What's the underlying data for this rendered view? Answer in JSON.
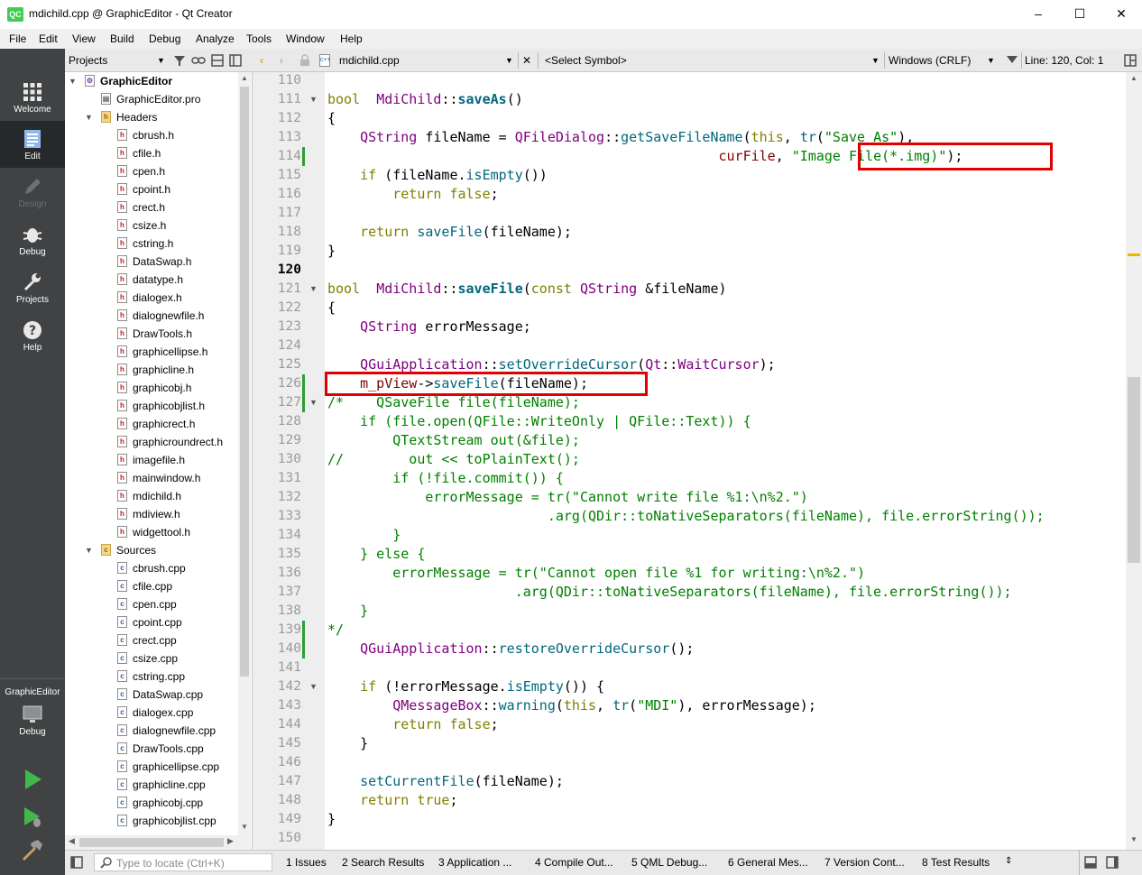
{
  "window": {
    "logo": "QC",
    "title": "mdichild.cpp @ GraphicEditor - Qt Creator",
    "minimize": "–",
    "maximize": "☐",
    "close": "✕"
  },
  "menu": [
    "File",
    "Edit",
    "View",
    "Build",
    "Debug",
    "Analyze",
    "Tools",
    "Window",
    "Help"
  ],
  "modes": {
    "welcome": "Welcome",
    "edit": "Edit",
    "design": "Design",
    "debug": "Debug",
    "projects": "Projects",
    "help": "Help",
    "target_project": "GraphicEditor",
    "target_config": "Debug"
  },
  "project_panel": {
    "title": "Projects",
    "tree": [
      {
        "label": "GraphicEditor",
        "depth": 0,
        "kind": "project",
        "expanded": true
      },
      {
        "label": "GraphicEditor.pro",
        "depth": 1,
        "kind": "pro"
      },
      {
        "label": "Headers",
        "depth": 1,
        "kind": "folder",
        "expanded": true
      },
      {
        "label": "cbrush.h",
        "depth": 2,
        "kind": "h"
      },
      {
        "label": "cfile.h",
        "depth": 2,
        "kind": "h"
      },
      {
        "label": "cpen.h",
        "depth": 2,
        "kind": "h"
      },
      {
        "label": "cpoint.h",
        "depth": 2,
        "kind": "h"
      },
      {
        "label": "crect.h",
        "depth": 2,
        "kind": "h"
      },
      {
        "label": "csize.h",
        "depth": 2,
        "kind": "h"
      },
      {
        "label": "cstring.h",
        "depth": 2,
        "kind": "h"
      },
      {
        "label": "DataSwap.h",
        "depth": 2,
        "kind": "h"
      },
      {
        "label": "datatype.h",
        "depth": 2,
        "kind": "h"
      },
      {
        "label": "dialogex.h",
        "depth": 2,
        "kind": "h"
      },
      {
        "label": "dialognewfile.h",
        "depth": 2,
        "kind": "h"
      },
      {
        "label": "DrawTools.h",
        "depth": 2,
        "kind": "h"
      },
      {
        "label": "graphicellipse.h",
        "depth": 2,
        "kind": "h"
      },
      {
        "label": "graphicline.h",
        "depth": 2,
        "kind": "h"
      },
      {
        "label": "graphicobj.h",
        "depth": 2,
        "kind": "h"
      },
      {
        "label": "graphicobjlist.h",
        "depth": 2,
        "kind": "h"
      },
      {
        "label": "graphicrect.h",
        "depth": 2,
        "kind": "h"
      },
      {
        "label": "graphicroundrect.h",
        "depth": 2,
        "kind": "h"
      },
      {
        "label": "imagefile.h",
        "depth": 2,
        "kind": "h"
      },
      {
        "label": "mainwindow.h",
        "depth": 2,
        "kind": "h"
      },
      {
        "label": "mdichild.h",
        "depth": 2,
        "kind": "h"
      },
      {
        "label": "mdiview.h",
        "depth": 2,
        "kind": "h"
      },
      {
        "label": "widgettool.h",
        "depth": 2,
        "kind": "h"
      },
      {
        "label": "Sources",
        "depth": 1,
        "kind": "folder",
        "expanded": true
      },
      {
        "label": "cbrush.cpp",
        "depth": 2,
        "kind": "cpp"
      },
      {
        "label": "cfile.cpp",
        "depth": 2,
        "kind": "cpp"
      },
      {
        "label": "cpen.cpp",
        "depth": 2,
        "kind": "cpp"
      },
      {
        "label": "cpoint.cpp",
        "depth": 2,
        "kind": "cpp"
      },
      {
        "label": "crect.cpp",
        "depth": 2,
        "kind": "cpp"
      },
      {
        "label": "csize.cpp",
        "depth": 2,
        "kind": "cpp"
      },
      {
        "label": "cstring.cpp",
        "depth": 2,
        "kind": "cpp"
      },
      {
        "label": "DataSwap.cpp",
        "depth": 2,
        "kind": "cpp"
      },
      {
        "label": "dialogex.cpp",
        "depth": 2,
        "kind": "cpp"
      },
      {
        "label": "dialognewfile.cpp",
        "depth": 2,
        "kind": "cpp"
      },
      {
        "label": "DrawTools.cpp",
        "depth": 2,
        "kind": "cpp"
      },
      {
        "label": "graphicellipse.cpp",
        "depth": 2,
        "kind": "cpp"
      },
      {
        "label": "graphicline.cpp",
        "depth": 2,
        "kind": "cpp"
      },
      {
        "label": "graphicobj.cpp",
        "depth": 2,
        "kind": "cpp"
      },
      {
        "label": "graphicobjlist.cpp",
        "depth": 2,
        "kind": "cpp"
      }
    ]
  },
  "editor_toolbar": {
    "file": "mdichild.cpp",
    "symbol": "<Select Symbol>",
    "line_ending": "Windows (CRLF)",
    "position": "Line: 120, Col: 1"
  },
  "editor": {
    "current_line": 120,
    "lines": [
      {
        "n": 110,
        "tokens": []
      },
      {
        "n": 111,
        "fold": true,
        "tokens": [
          [
            "kw",
            "bool"
          ],
          [
            "",
            "  "
          ],
          [
            "ty",
            "MdiChild"
          ],
          [
            "",
            "::"
          ],
          [
            "fnb",
            "saveAs"
          ],
          [
            "",
            "()"
          ]
        ]
      },
      {
        "n": 112,
        "tokens": [
          [
            "",
            "{"
          ]
        ]
      },
      {
        "n": 113,
        "tokens": [
          [
            "",
            "    "
          ],
          [
            "ty",
            "QString"
          ],
          [
            "",
            " fileName = "
          ],
          [
            "ty",
            "QFileDialog"
          ],
          [
            "",
            "::"
          ],
          [
            "fn",
            "getSaveFileName"
          ],
          [
            "",
            "("
          ],
          [
            "kw",
            "this"
          ],
          [
            "",
            ", "
          ],
          [
            "fn",
            "tr"
          ],
          [
            "",
            "("
          ],
          [
            "st",
            "\"Save As\""
          ],
          [
            "",
            "),"
          ]
        ]
      },
      {
        "n": 114,
        "mark": true,
        "tokens": [
          [
            "",
            "                                                "
          ],
          [
            "var",
            "curFile"
          ],
          [
            "",
            ", "
          ],
          [
            "st",
            "\"Image File(*.img)\""
          ],
          [
            "",
            ");"
          ]
        ]
      },
      {
        "n": 115,
        "tokens": [
          [
            "",
            "    "
          ],
          [
            "kw",
            "if"
          ],
          [
            "",
            " (fileName."
          ],
          [
            "fn",
            "isEmpty"
          ],
          [
            "",
            "())"
          ]
        ]
      },
      {
        "n": 116,
        "tokens": [
          [
            "",
            "        "
          ],
          [
            "kw",
            "return"
          ],
          [
            "",
            " "
          ],
          [
            "kw",
            "false"
          ],
          [
            "",
            ";"
          ]
        ]
      },
      {
        "n": 117,
        "tokens": []
      },
      {
        "n": 118,
        "tokens": [
          [
            "",
            "    "
          ],
          [
            "kw",
            "return"
          ],
          [
            "",
            " "
          ],
          [
            "fn",
            "saveFile"
          ],
          [
            "",
            "(fileName);"
          ]
        ]
      },
      {
        "n": 119,
        "tokens": [
          [
            "",
            "}"
          ]
        ]
      },
      {
        "n": 120,
        "tokens": []
      },
      {
        "n": 121,
        "fold": true,
        "tokens": [
          [
            "kw",
            "bool"
          ],
          [
            "",
            "  "
          ],
          [
            "ty",
            "MdiChild"
          ],
          [
            "",
            "::"
          ],
          [
            "fnb",
            "saveFile"
          ],
          [
            "",
            "("
          ],
          [
            "kw",
            "const"
          ],
          [
            "",
            " "
          ],
          [
            "ty",
            "QString"
          ],
          [
            "",
            " &fileName)"
          ]
        ]
      },
      {
        "n": 122,
        "tokens": [
          [
            "",
            "{"
          ]
        ]
      },
      {
        "n": 123,
        "tokens": [
          [
            "",
            "    "
          ],
          [
            "ty",
            "QString"
          ],
          [
            "",
            " errorMessage;"
          ]
        ]
      },
      {
        "n": 124,
        "tokens": []
      },
      {
        "n": 125,
        "tokens": [
          [
            "",
            "    "
          ],
          [
            "ty",
            "QGuiApplication"
          ],
          [
            "",
            "::"
          ],
          [
            "fn",
            "setOverrideCursor"
          ],
          [
            "",
            "("
          ],
          [
            "ty",
            "Qt"
          ],
          [
            "",
            "::"
          ],
          [
            "ty",
            "WaitCursor"
          ],
          [
            "",
            ");"
          ]
        ]
      },
      {
        "n": 126,
        "mark": true,
        "tokens": [
          [
            "",
            "    "
          ],
          [
            "var",
            "m_pView"
          ],
          [
            "",
            "->"
          ],
          [
            "fn",
            "saveFile"
          ],
          [
            "",
            "(fileName);"
          ]
        ]
      },
      {
        "n": 127,
        "fold": true,
        "mark": true,
        "tokens": [
          [
            "cm",
            "/*    QSaveFile file(fileName);"
          ]
        ]
      },
      {
        "n": 128,
        "tokens": [
          [
            "cm",
            "    if (file.open(QFile::WriteOnly | QFile::Text)) {"
          ]
        ]
      },
      {
        "n": 129,
        "tokens": [
          [
            "cm",
            "        QTextStream out(&file);"
          ]
        ]
      },
      {
        "n": 130,
        "tokens": [
          [
            "cm",
            "//        out << toPlainText();"
          ]
        ]
      },
      {
        "n": 131,
        "tokens": [
          [
            "cm",
            "        if (!file.commit()) {"
          ]
        ]
      },
      {
        "n": 132,
        "tokens": [
          [
            "cm",
            "            errorMessage = tr(\"Cannot write file %1:\\n%2.\")"
          ]
        ]
      },
      {
        "n": 133,
        "tokens": [
          [
            "cm",
            "                           .arg(QDir::toNativeSeparators(fileName), file.errorString());"
          ]
        ]
      },
      {
        "n": 134,
        "tokens": [
          [
            "cm",
            "        }"
          ]
        ]
      },
      {
        "n": 135,
        "tokens": [
          [
            "cm",
            "    } else {"
          ]
        ]
      },
      {
        "n": 136,
        "tokens": [
          [
            "cm",
            "        errorMessage = tr(\"Cannot open file %1 for writing:\\n%2.\")"
          ]
        ]
      },
      {
        "n": 137,
        "tokens": [
          [
            "cm",
            "                       .arg(QDir::toNativeSeparators(fileName), file.errorString());"
          ]
        ]
      },
      {
        "n": 138,
        "tokens": [
          [
            "cm",
            "    }"
          ]
        ]
      },
      {
        "n": 139,
        "mark": true,
        "tokens": [
          [
            "cm",
            "*/"
          ]
        ]
      },
      {
        "n": 140,
        "mark": true,
        "tokens": [
          [
            "",
            "    "
          ],
          [
            "ty",
            "QGuiApplication"
          ],
          [
            "",
            "::"
          ],
          [
            "fn",
            "restoreOverrideCursor"
          ],
          [
            "",
            "();"
          ]
        ]
      },
      {
        "n": 141,
        "tokens": []
      },
      {
        "n": 142,
        "fold": true,
        "tokens": [
          [
            "",
            "    "
          ],
          [
            "kw",
            "if"
          ],
          [
            "",
            " (!errorMessage."
          ],
          [
            "fn",
            "isEmpty"
          ],
          [
            "",
            "()) {"
          ]
        ]
      },
      {
        "n": 143,
        "tokens": [
          [
            "",
            "        "
          ],
          [
            "ty",
            "QMessageBox"
          ],
          [
            "",
            "::"
          ],
          [
            "fn",
            "warning"
          ],
          [
            "",
            "("
          ],
          [
            "kw",
            "this"
          ],
          [
            "",
            ", "
          ],
          [
            "fn",
            "tr"
          ],
          [
            "",
            "("
          ],
          [
            "st",
            "\"MDI\""
          ],
          [
            "",
            "), errorMessage);"
          ]
        ]
      },
      {
        "n": 144,
        "tokens": [
          [
            "",
            "        "
          ],
          [
            "kw",
            "return"
          ],
          [
            "",
            " "
          ],
          [
            "kw",
            "false"
          ],
          [
            "",
            ";"
          ]
        ]
      },
      {
        "n": 145,
        "tokens": [
          [
            "",
            "    }"
          ]
        ]
      },
      {
        "n": 146,
        "tokens": []
      },
      {
        "n": 147,
        "tokens": [
          [
            "",
            "    "
          ],
          [
            "fn",
            "setCurrentFile"
          ],
          [
            "",
            "(fileName);"
          ]
        ]
      },
      {
        "n": 148,
        "tokens": [
          [
            "",
            "    "
          ],
          [
            "kw",
            "return"
          ],
          [
            "",
            " "
          ],
          [
            "kw",
            "true"
          ],
          [
            "",
            ";"
          ]
        ]
      },
      {
        "n": 149,
        "tokens": [
          [
            "",
            "}"
          ]
        ]
      },
      {
        "n": 150,
        "tokens": []
      }
    ]
  },
  "statusbar": {
    "locator_placeholder": "Type to locate (Ctrl+K)",
    "panes": [
      "1  Issues",
      "2  Search Results",
      "3  Application ...",
      "4  Compile Out...",
      "5  QML Debug...",
      "6  General Mes...",
      "7  Version Cont...",
      "8  Test Results"
    ]
  },
  "colors": {
    "modebar": "#404244",
    "keyword": "#808000",
    "type": "#800080",
    "function": "#00677c",
    "string": "#008000",
    "member": "#800000",
    "highlight_box": "#e00000",
    "changed_line": "#2ba037"
  }
}
